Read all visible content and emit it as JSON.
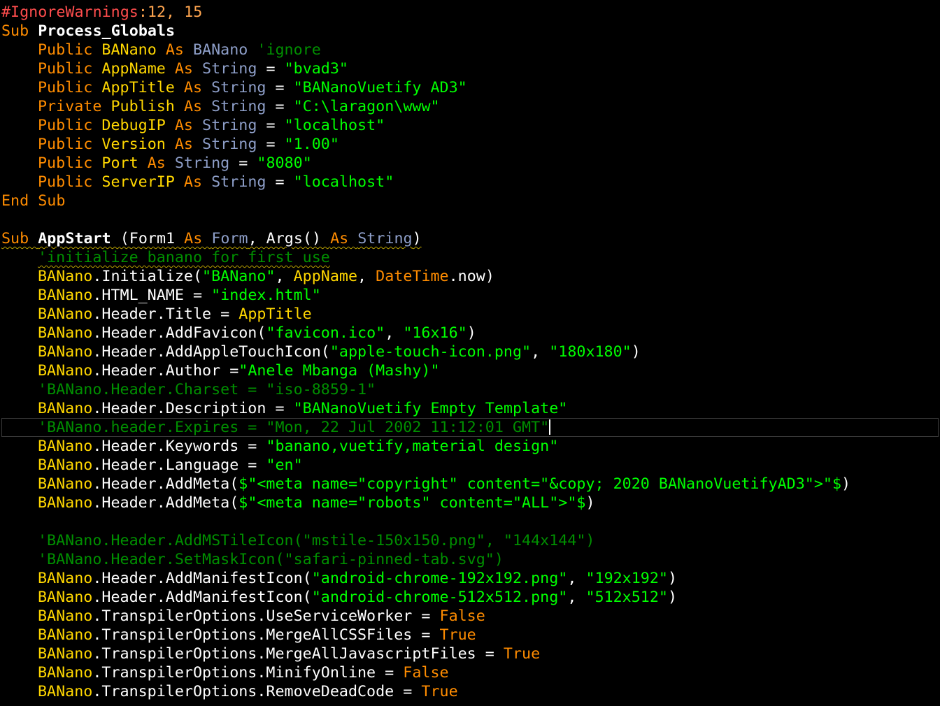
{
  "theme": {
    "background": "#000000",
    "keyword": "#ff8c00",
    "identifier": "#ffd700",
    "type": "#8e9fc9",
    "string": "#00ff00",
    "comment": "#008f00",
    "directive": "#ff4d4d",
    "number": "#ffa54f",
    "default": "#ffffff",
    "boolean": "#ff8c00"
  },
  "editor": {
    "current_line": 22,
    "lines": [
      {
        "indent": 0,
        "tokens": [
          {
            "t": "#IgnoreWarnings",
            "c": "directive"
          },
          {
            "t": ":12, 15",
            "c": "number"
          }
        ]
      },
      {
        "indent": 0,
        "tokens": [
          {
            "t": "Sub ",
            "c": "keyword"
          },
          {
            "t": "Process_Globals",
            "c": "default",
            "b": true
          }
        ]
      },
      {
        "indent": 1,
        "tokens": [
          {
            "t": "Public ",
            "c": "keyword"
          },
          {
            "t": "BANano ",
            "c": "identifier"
          },
          {
            "t": "As ",
            "c": "keyword"
          },
          {
            "t": "BANano ",
            "c": "type"
          },
          {
            "t": "'ignore",
            "c": "comment"
          }
        ]
      },
      {
        "indent": 1,
        "tokens": [
          {
            "t": "Public ",
            "c": "keyword"
          },
          {
            "t": "AppName ",
            "c": "identifier"
          },
          {
            "t": "As ",
            "c": "keyword"
          },
          {
            "t": "String ",
            "c": "type"
          },
          {
            "t": "= ",
            "c": "default"
          },
          {
            "t": "\"bvad3\"",
            "c": "string"
          }
        ]
      },
      {
        "indent": 1,
        "tokens": [
          {
            "t": "Public ",
            "c": "keyword"
          },
          {
            "t": "AppTitle ",
            "c": "identifier"
          },
          {
            "t": "As ",
            "c": "keyword"
          },
          {
            "t": "String ",
            "c": "type"
          },
          {
            "t": "= ",
            "c": "default"
          },
          {
            "t": "\"BANanoVuetify AD3\"",
            "c": "string"
          }
        ]
      },
      {
        "indent": 1,
        "tokens": [
          {
            "t": "Private ",
            "c": "keyword"
          },
          {
            "t": "Publish ",
            "c": "identifier"
          },
          {
            "t": "As ",
            "c": "keyword"
          },
          {
            "t": "String ",
            "c": "type"
          },
          {
            "t": "= ",
            "c": "default"
          },
          {
            "t": "\"C:\\laragon\\www\"",
            "c": "string"
          }
        ]
      },
      {
        "indent": 1,
        "tokens": [
          {
            "t": "Public ",
            "c": "keyword"
          },
          {
            "t": "DebugIP ",
            "c": "identifier"
          },
          {
            "t": "As ",
            "c": "keyword"
          },
          {
            "t": "String ",
            "c": "type"
          },
          {
            "t": "= ",
            "c": "default"
          },
          {
            "t": "\"localhost\"",
            "c": "string"
          }
        ]
      },
      {
        "indent": 1,
        "tokens": [
          {
            "t": "Public ",
            "c": "keyword"
          },
          {
            "t": "Version ",
            "c": "identifier"
          },
          {
            "t": "As ",
            "c": "keyword"
          },
          {
            "t": "String ",
            "c": "type"
          },
          {
            "t": "= ",
            "c": "default"
          },
          {
            "t": "\"1.00\"",
            "c": "string"
          }
        ]
      },
      {
        "indent": 1,
        "tokens": [
          {
            "t": "Public ",
            "c": "keyword"
          },
          {
            "t": "Port ",
            "c": "identifier"
          },
          {
            "t": "As ",
            "c": "keyword"
          },
          {
            "t": "String ",
            "c": "type"
          },
          {
            "t": "= ",
            "c": "default"
          },
          {
            "t": "\"8080\"",
            "c": "string"
          }
        ]
      },
      {
        "indent": 1,
        "tokens": [
          {
            "t": "Public ",
            "c": "keyword"
          },
          {
            "t": "ServerIP ",
            "c": "identifier"
          },
          {
            "t": "As ",
            "c": "keyword"
          },
          {
            "t": "String ",
            "c": "type"
          },
          {
            "t": "= ",
            "c": "default"
          },
          {
            "t": "\"localhost\"",
            "c": "string"
          }
        ]
      },
      {
        "indent": 0,
        "tokens": [
          {
            "t": "End Sub",
            "c": "keyword"
          }
        ]
      },
      {
        "indent": 0,
        "tokens": []
      },
      {
        "indent": 0,
        "squiggle": true,
        "tokens": [
          {
            "t": "Sub ",
            "c": "keyword"
          },
          {
            "t": "AppStart ",
            "c": "default",
            "b": true
          },
          {
            "t": "(Form1 ",
            "c": "default"
          },
          {
            "t": "As ",
            "c": "keyword"
          },
          {
            "t": "Form",
            "c": "type"
          },
          {
            "t": ", Args() ",
            "c": "default"
          },
          {
            "t": "As ",
            "c": "keyword"
          },
          {
            "t": "String",
            "c": "type"
          },
          {
            "t": ")",
            "c": "default"
          }
        ]
      },
      {
        "indent": 1,
        "squiggle": true,
        "tokens": [
          {
            "t": "'initialize banano for first use",
            "c": "comment"
          }
        ]
      },
      {
        "indent": 1,
        "tokens": [
          {
            "t": "BANano",
            "c": "identifier"
          },
          {
            "t": ".Initialize(",
            "c": "default"
          },
          {
            "t": "\"BANano\"",
            "c": "string"
          },
          {
            "t": ", ",
            "c": "default"
          },
          {
            "t": "AppName",
            "c": "identifier"
          },
          {
            "t": ", ",
            "c": "default"
          },
          {
            "t": "DateTime",
            "c": "keyword"
          },
          {
            "t": ".now)",
            "c": "default"
          }
        ]
      },
      {
        "indent": 1,
        "tokens": [
          {
            "t": "BANano",
            "c": "identifier"
          },
          {
            "t": ".HTML_NAME = ",
            "c": "default"
          },
          {
            "t": "\"index.html\"",
            "c": "string"
          }
        ]
      },
      {
        "indent": 1,
        "tokens": [
          {
            "t": "BANano",
            "c": "identifier"
          },
          {
            "t": ".Header.Title = ",
            "c": "default"
          },
          {
            "t": "AppTitle",
            "c": "identifier"
          }
        ]
      },
      {
        "indent": 1,
        "tokens": [
          {
            "t": "BANano",
            "c": "identifier"
          },
          {
            "t": ".Header.AddFavicon(",
            "c": "default"
          },
          {
            "t": "\"favicon.ico\"",
            "c": "string"
          },
          {
            "t": ", ",
            "c": "default"
          },
          {
            "t": "\"16x16\"",
            "c": "string"
          },
          {
            "t": ")",
            "c": "default"
          }
        ]
      },
      {
        "indent": 1,
        "tokens": [
          {
            "t": "BANano",
            "c": "identifier"
          },
          {
            "t": ".Header.AddAppleTouchIcon(",
            "c": "default"
          },
          {
            "t": "\"apple-touch-icon.png\"",
            "c": "string"
          },
          {
            "t": ", ",
            "c": "default"
          },
          {
            "t": "\"180x180\"",
            "c": "string"
          },
          {
            "t": ")",
            "c": "default"
          }
        ]
      },
      {
        "indent": 1,
        "tokens": [
          {
            "t": "BANano",
            "c": "identifier"
          },
          {
            "t": ".Header.Author =",
            "c": "default"
          },
          {
            "t": "\"Anele Mbanga (Mashy)\"",
            "c": "string"
          }
        ]
      },
      {
        "indent": 1,
        "tokens": [
          {
            "t": "'BANano.Header.Charset = \"iso-8859-1\"",
            "c": "comment"
          }
        ]
      },
      {
        "indent": 1,
        "tokens": [
          {
            "t": "BANano",
            "c": "identifier"
          },
          {
            "t": ".Header.Description = ",
            "c": "default"
          },
          {
            "t": "\"BANanoVuetify Empty Template\"",
            "c": "string"
          }
        ]
      },
      {
        "indent": 1,
        "caret": true,
        "tokens": [
          {
            "t": "'BANano.header.Expires = \"Mon, 22 Jul 2002 11:12:01 GMT\"",
            "c": "comment"
          }
        ]
      },
      {
        "indent": 1,
        "tokens": [
          {
            "t": "BANano",
            "c": "identifier"
          },
          {
            "t": ".Header.Keywords = ",
            "c": "default"
          },
          {
            "t": "\"banano,vuetify,material design\"",
            "c": "string"
          }
        ]
      },
      {
        "indent": 1,
        "tokens": [
          {
            "t": "BANano",
            "c": "identifier"
          },
          {
            "t": ".Header.Language = ",
            "c": "default"
          },
          {
            "t": "\"en\"",
            "c": "string"
          }
        ]
      },
      {
        "indent": 1,
        "tokens": [
          {
            "t": "BANano",
            "c": "identifier"
          },
          {
            "t": ".Header.AddMeta(",
            "c": "default"
          },
          {
            "t": "$\"<meta name=\"copyright\" content=\"&copy; 2020 BANanoVuetifyAD3\">\"$",
            "c": "string"
          },
          {
            "t": ")",
            "c": "default"
          }
        ]
      },
      {
        "indent": 1,
        "tokens": [
          {
            "t": "BANano",
            "c": "identifier"
          },
          {
            "t": ".Header.AddMeta(",
            "c": "default"
          },
          {
            "t": "$\"<meta name=\"robots\" content=\"ALL\">\"$",
            "c": "string"
          },
          {
            "t": ")",
            "c": "default"
          }
        ]
      },
      {
        "indent": 0,
        "tokens": []
      },
      {
        "indent": 1,
        "tokens": [
          {
            "t": "'BANano.Header.AddMSTileIcon(\"mstile-150x150.png\", \"144x144\")",
            "c": "comment"
          }
        ]
      },
      {
        "indent": 1,
        "tokens": [
          {
            "t": "'BANano.Header.SetMaskIcon(\"safari-pinned-tab.svg\")",
            "c": "comment"
          }
        ]
      },
      {
        "indent": 1,
        "tokens": [
          {
            "t": "BANano",
            "c": "identifier"
          },
          {
            "t": ".Header.AddManifestIcon(",
            "c": "default"
          },
          {
            "t": "\"android-chrome-192x192.png\"",
            "c": "string"
          },
          {
            "t": ", ",
            "c": "default"
          },
          {
            "t": "\"192x192\"",
            "c": "string"
          },
          {
            "t": ")",
            "c": "default"
          }
        ]
      },
      {
        "indent": 1,
        "tokens": [
          {
            "t": "BANano",
            "c": "identifier"
          },
          {
            "t": ".Header.AddManifestIcon(",
            "c": "default"
          },
          {
            "t": "\"android-chrome-512x512.png\"",
            "c": "string"
          },
          {
            "t": ", ",
            "c": "default"
          },
          {
            "t": "\"512x512\"",
            "c": "string"
          },
          {
            "t": ")",
            "c": "default"
          }
        ]
      },
      {
        "indent": 1,
        "tokens": [
          {
            "t": "BANano",
            "c": "identifier"
          },
          {
            "t": ".TranspilerOptions.UseServiceWorker = ",
            "c": "default"
          },
          {
            "t": "False",
            "c": "boolean"
          }
        ]
      },
      {
        "indent": 1,
        "tokens": [
          {
            "t": "BANano",
            "c": "identifier"
          },
          {
            "t": ".TranspilerOptions.MergeAllCSSFiles = ",
            "c": "default"
          },
          {
            "t": "True",
            "c": "boolean"
          }
        ]
      },
      {
        "indent": 1,
        "tokens": [
          {
            "t": "BANano",
            "c": "identifier"
          },
          {
            "t": ".TranspilerOptions.MergeAllJavascriptFiles = ",
            "c": "default"
          },
          {
            "t": "True",
            "c": "boolean"
          }
        ]
      },
      {
        "indent": 1,
        "tokens": [
          {
            "t": "BANano",
            "c": "identifier"
          },
          {
            "t": ".TranspilerOptions.MinifyOnline = ",
            "c": "default"
          },
          {
            "t": "False",
            "c": "boolean"
          }
        ]
      },
      {
        "indent": 1,
        "tokens": [
          {
            "t": "BANano",
            "c": "identifier"
          },
          {
            "t": ".TranspilerOptions.RemoveDeadCode = ",
            "c": "default"
          },
          {
            "t": "True",
            "c": "boolean"
          }
        ]
      }
    ]
  }
}
